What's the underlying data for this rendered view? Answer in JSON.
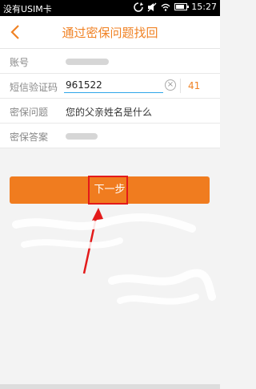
{
  "status_bar": {
    "carrier": "没有USIM卡",
    "time": "15:27"
  },
  "header": {
    "title": "通过密保问题找回"
  },
  "form": {
    "account": {
      "label": "账号"
    },
    "sms_code": {
      "label": "短信验证码",
      "value": "961522",
      "countdown": "41"
    },
    "question": {
      "label": "密保问题",
      "value": "您的父亲姓名是什么"
    },
    "answer": {
      "label": "密保答案"
    }
  },
  "next_button": {
    "label": "下一步"
  },
  "colors": {
    "accent": "#f08224",
    "highlight": "#e31a1a"
  }
}
